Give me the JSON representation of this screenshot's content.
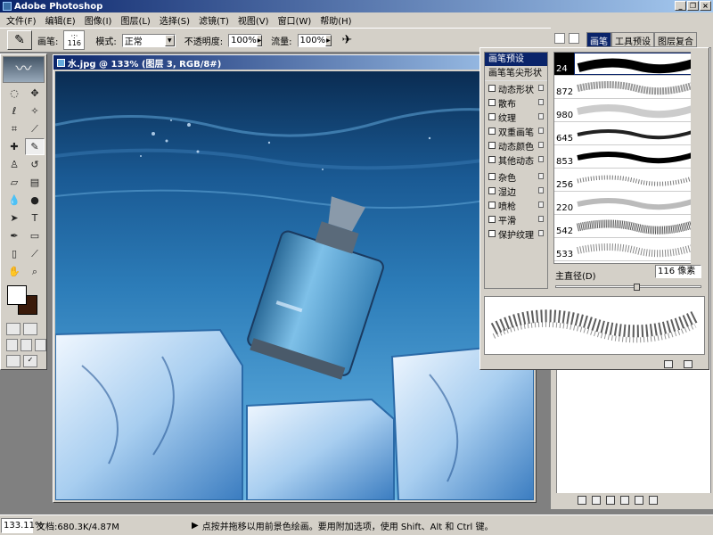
{
  "app": {
    "title": "Adobe Photoshop"
  },
  "window_buttons": {
    "minimize": "_",
    "restore": "❐",
    "close": "×"
  },
  "menu": [
    "文件(F)",
    "编辑(E)",
    "图像(I)",
    "图层(L)",
    "选择(S)",
    "滤镜(T)",
    "视图(V)",
    "窗口(W)",
    "帮助(H)"
  ],
  "options": {
    "brush_label": "画笔:",
    "brush_size": "116",
    "mode_label": "模式:",
    "mode_value": "正常",
    "opacity_label": "不透明度:",
    "opacity_value": "100%",
    "flow_label": "流量:",
    "flow_value": "100%"
  },
  "document": {
    "title": "水.jpg @ 133% (图层 3, RGB/8#)"
  },
  "brush_panel": {
    "header": "画笔预设",
    "tip_shape": "画笔笔尖形状",
    "options": [
      "动态形状",
      "散布",
      "纹理",
      "双重画笔",
      "动态颜色",
      "其他动态",
      "杂色",
      "湿边",
      "喷枪",
      "平滑",
      "保护纹理"
    ],
    "sizes": [
      "24",
      "872",
      "980",
      "645",
      "853",
      "256",
      "220",
      "542",
      "533"
    ],
    "diameter_label": "主直径(D)",
    "diameter_value": "116 像素",
    "diameter_fraction": 0.56
  },
  "dock": {
    "tabs": [
      "画笔",
      "工具预设",
      "图层复合"
    ]
  },
  "status": {
    "zoom": "133.11%",
    "doc_size": "文档:680.3K/4.87M",
    "hint": "点按并拖移以用前景色绘画。要用附加选项，使用 Shift、Alt 和 Ctrl 键。"
  },
  "colors": {
    "foreground": "#ffffff",
    "background": "#3a1a0a",
    "title_bar": "#0a246a",
    "chrome": "#d4d0c8"
  }
}
